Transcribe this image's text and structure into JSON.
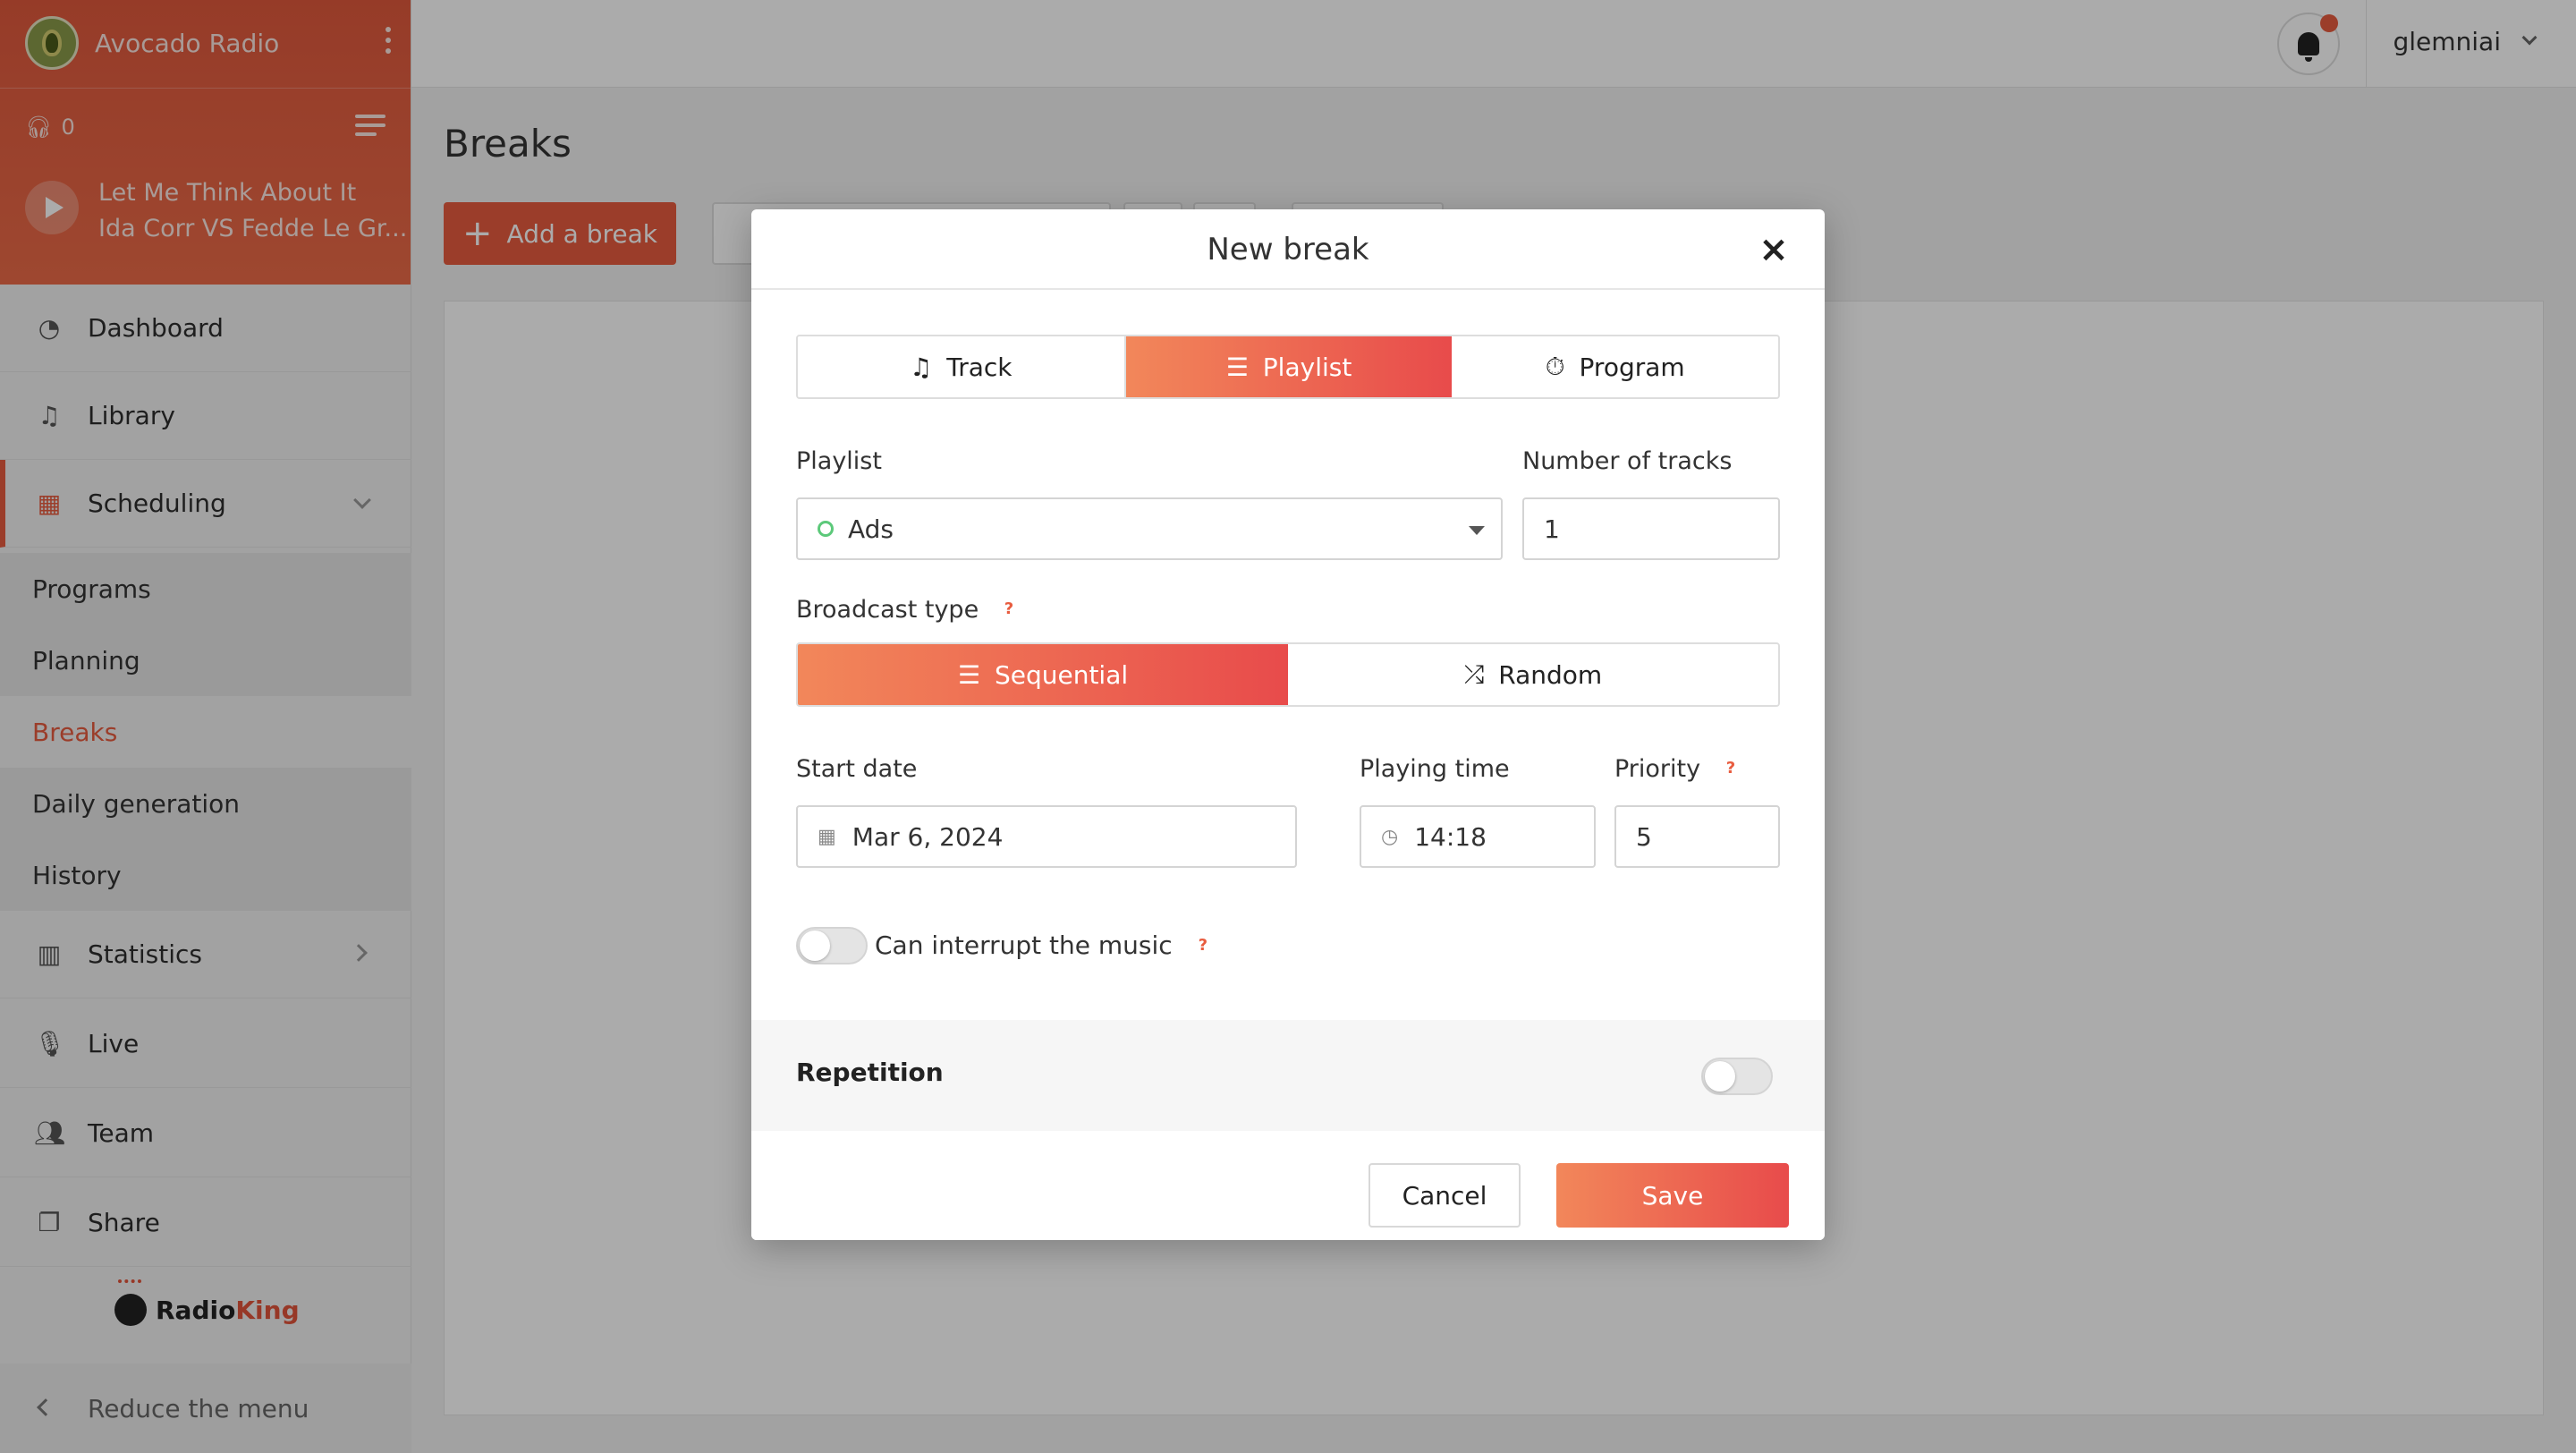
{
  "sidebar": {
    "station_name": "Avocado Radio",
    "listeners": "0",
    "now_playing": {
      "title": "Let Me Think About It",
      "artist": "Ida Corr VS Fedde Le Gr..."
    },
    "menu": {
      "dashboard": "Dashboard",
      "library": "Library",
      "scheduling": "Scheduling",
      "statistics": "Statistics",
      "live": "Live",
      "team": "Team",
      "share": "Share"
    },
    "submenu": {
      "programs": "Programs",
      "planning": "Planning",
      "breaks": "Breaks",
      "daily_generation": "Daily generation",
      "history": "History"
    },
    "brand": {
      "radio": "Radio",
      "king": "King"
    },
    "reduce_label": "Reduce the menu"
  },
  "topbar": {
    "username": "glemniai"
  },
  "page": {
    "title": "Breaks",
    "add_label": "Add a break"
  },
  "modal": {
    "title": "New break",
    "close_glyph": "×",
    "type_tabs": {
      "track": "Track",
      "playlist": "Playlist",
      "program": "Program",
      "selected": "Playlist"
    },
    "playlist_label": "Playlist",
    "playlist_value": "Ads",
    "tracks_label": "Number of tracks",
    "tracks_value": "1",
    "broadcast_label": "Broadcast type",
    "broadcast": {
      "sequential": "Sequential",
      "random": "Random",
      "selected": "Sequential"
    },
    "start_date_label": "Start date",
    "start_date_value": "Mar 6, 2024",
    "playing_time_label": "Playing time",
    "playing_time_value": "14:18",
    "priority_label": "Priority",
    "priority_value": "5",
    "interrupt_label": "Can interrupt the music",
    "interrupt_on": false,
    "repetition_label": "Repetition",
    "repetition_on": false,
    "help_glyph": "?",
    "cancel_label": "Cancel",
    "save_label": "Save"
  },
  "colors": {
    "accent": "#e85c3f",
    "gradient_start": "#f2875a",
    "gradient_end": "#e84b4b",
    "status_ok": "#5cc97a"
  }
}
